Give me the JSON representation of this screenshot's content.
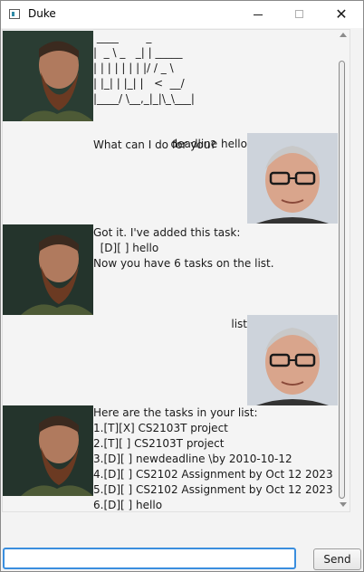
{
  "window": {
    "title": "Duke",
    "controls": {
      "minimize_icon": "minimize-icon",
      "maximize_icon": "maximize-icon",
      "close_icon": "close-icon",
      "close_glyph": "✕"
    }
  },
  "dialogs": [
    {
      "speaker": "duke",
      "avatar": "bearded-man-avatar",
      "text": " ____        _\n|  _ \\ _   _| | _____\n| | | | | | | |/ / _ \\\n| |_| | |_| |   <  __/\n|____/ \\__,_|_|\\_\\___|\n\n\nWhat can I do for you?"
    },
    {
      "speaker": "user",
      "avatar": "older-man-glasses-avatar",
      "text": "deadline hello"
    },
    {
      "speaker": "duke",
      "avatar": "bearded-man-avatar",
      "text": "Got it. I've added this task:\n  [D][ ] hello\nNow you have 6 tasks on the list."
    },
    {
      "speaker": "user",
      "avatar": "older-man-glasses-avatar",
      "text": "list"
    },
    {
      "speaker": "duke",
      "avatar": "bearded-man-avatar",
      "text": "Here are the tasks in your list:\n1.[T][X] CS2103T project\n2.[T][ ] CS2103T project\n3.[D][ ] newdeadline \\by 2010-10-12\n4.[D][ ] CS2102 Assignment by Oct 12 2023\n5.[D][ ] CS2102 Assignment by Oct 12 2023\n6.[D][ ] hello"
    }
  ],
  "input": {
    "value": "",
    "placeholder": ""
  },
  "send_button": {
    "label": "Send"
  },
  "colors": {
    "focus_border": "#3a8ede",
    "background": "#f3f3f3"
  }
}
